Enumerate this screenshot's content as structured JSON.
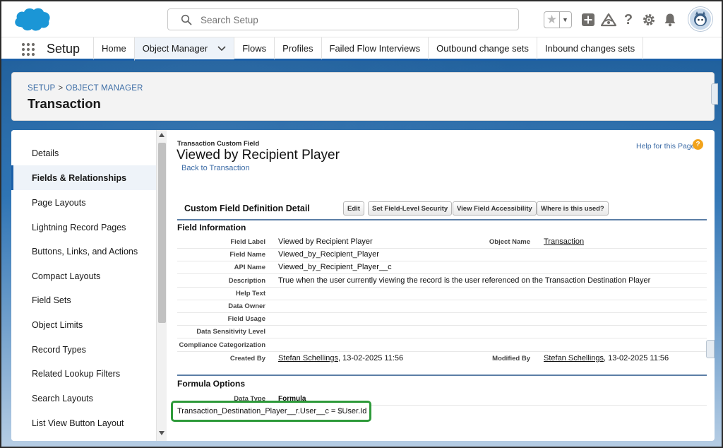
{
  "header": {
    "search_placeholder": "Search Setup",
    "icons": [
      "favorites-star-icon",
      "add-icon",
      "trailhead-icon",
      "help-icon",
      "settings-gear-icon",
      "notifications-bell-icon",
      "user-avatar-icon"
    ]
  },
  "nav": {
    "app_name": "Setup",
    "tabs": [
      {
        "label": "Home"
      },
      {
        "label": "Object Manager",
        "active": true
      },
      {
        "label": "Flows"
      },
      {
        "label": "Profiles"
      },
      {
        "label": "Failed Flow Interviews"
      },
      {
        "label": "Outbound change sets"
      },
      {
        "label": "Inbound changes sets"
      }
    ]
  },
  "page_header": {
    "crumb_setup": "SETUP",
    "crumb_sep": ">",
    "crumb_object_manager": "OBJECT MANAGER",
    "title": "Transaction"
  },
  "sidebar": {
    "items": [
      {
        "label": "Details"
      },
      {
        "label": "Fields & Relationships",
        "active": true
      },
      {
        "label": "Page Layouts"
      },
      {
        "label": "Lightning Record Pages"
      },
      {
        "label": "Buttons, Links, and Actions"
      },
      {
        "label": "Compact Layouts"
      },
      {
        "label": "Field Sets"
      },
      {
        "label": "Object Limits"
      },
      {
        "label": "Record Types"
      },
      {
        "label": "Related Lookup Filters"
      },
      {
        "label": "Search Layouts"
      },
      {
        "label": "List View Button Layout"
      }
    ]
  },
  "content": {
    "type_label": "Transaction Custom Field",
    "title": "Viewed by Recipient Player",
    "back_link": "Back to Transaction",
    "help_link": "Help for this Page",
    "help_icon": "?",
    "detail_header": "Custom Field Definition Detail",
    "buttons": {
      "edit": "Edit",
      "fls": "Set Field-Level Security",
      "view_access": "View Field Accessibility",
      "where_used": "Where is this used?"
    },
    "field_info_heading": "Field Information",
    "rows": [
      {
        "label": "Field Label",
        "value": "Viewed by Recipient Player",
        "label2": "Object Name",
        "value2": "Transaction"
      },
      {
        "label": "Field Name",
        "value": "Viewed_by_Recipient_Player"
      },
      {
        "label": "API Name",
        "value": "Viewed_by_Recipient_Player__c"
      },
      {
        "label": "Description",
        "value": "True when the user currently viewing the record is the user referenced on the Transaction Destination Player"
      },
      {
        "label": "Help Text",
        "value": ""
      },
      {
        "label": "Data Owner",
        "value": ""
      },
      {
        "label": "Field Usage",
        "value": ""
      },
      {
        "label": "Data Sensitivity Level",
        "value": ""
      },
      {
        "label": "Compliance Categorization",
        "value": ""
      }
    ],
    "created_by": {
      "label": "Created By",
      "user": "Stefan Schellings",
      "date": ", 13-02-2025 11:56"
    },
    "modified_by": {
      "label": "Modified By",
      "user": "Stefan Schellings",
      "date": ", 13-02-2025 11:56"
    },
    "formula_heading": "Formula Options",
    "data_type_label": "Data Type",
    "data_type_value": "Formula",
    "formula": "Transaction_Destination_Player__r.User__c = $User.Id"
  },
  "colors": {
    "brand_blue": "#1b5fa8",
    "link_blue": "#3a6aa5",
    "highlight_green": "#2e9a3a",
    "help_orange": "#f2a31b"
  }
}
